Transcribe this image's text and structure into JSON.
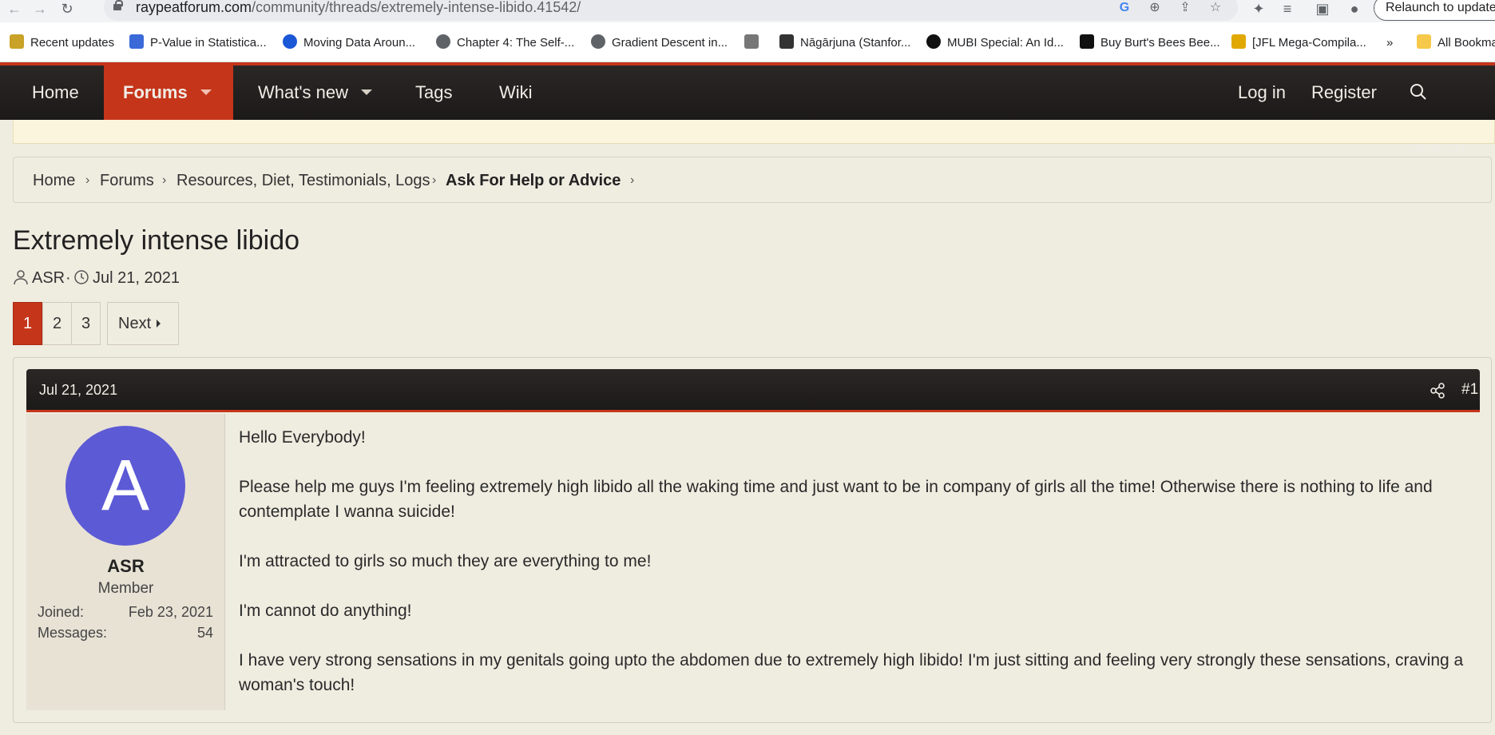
{
  "browser": {
    "url_domain": "raypeatforum.com",
    "url_path": "/community/threads/extremely-intense-libido.41542/",
    "relaunch_label": "Relaunch to update",
    "bookmarks": [
      {
        "label": "Recent updates",
        "color": "#c9a227"
      },
      {
        "label": "P-Value in Statistica...",
        "color": "#3b6ad8"
      },
      {
        "label": "Moving Data Aroun...",
        "color": "#1a57d6"
      },
      {
        "label": "Chapter 4: The Self-...",
        "color": "#5f6368"
      },
      {
        "label": "Gradient Descent in...",
        "color": "#5f6368"
      },
      {
        "label": "",
        "color": "#777777"
      },
      {
        "label": "Nāgārjuna (Stanfor...",
        "color": "#333333"
      },
      {
        "label": "MUBI Special: An Id...",
        "color": "#111111"
      },
      {
        "label": "Buy Burt's Bees Bee...",
        "color": "#111111"
      },
      {
        "label": "[JFL Mega-Compila...",
        "color": "#e0a800"
      },
      {
        "label": "»",
        "color": ""
      },
      {
        "label": "All Bookma",
        "color": "#f6c94a"
      }
    ]
  },
  "nav": {
    "home": "Home",
    "forums": "Forums",
    "whats_new": "What's new",
    "tags": "Tags",
    "wiki": "Wiki",
    "login": "Log in",
    "register": "Register",
    "search": "Search"
  },
  "breadcrumb": [
    "Home",
    "Forums",
    "Resources, Diet, Testimonials, Logs",
    "Ask For Help or Advice"
  ],
  "thread": {
    "title": "Extremely intense libido",
    "author": "ASR",
    "date": "Jul 21, 2021"
  },
  "pagination": {
    "pages": [
      "1",
      "2",
      "3"
    ],
    "current": "1",
    "next_label": "Next"
  },
  "post": {
    "date": "Jul 21, 2021",
    "number": "#1",
    "avatar_letter": "A",
    "avatar_color": "#5d5ad6",
    "username": "ASR",
    "user_title": "Member",
    "joined_label": "Joined:",
    "joined_value": "Feb 23, 2021",
    "messages_label": "Messages:",
    "messages_value": "54",
    "paragraphs": [
      "Hello Everybody!",
      "Please help me guys I'm feeling extremely high libido all the waking time and just want to be in company of girls all the time! Otherwise there is nothing to life and contemplate I wanna suicide!",
      "I'm attracted to girls so much they are everything to me!",
      "I'm cannot do anything!",
      "I have very strong sensations in my genitals going upto the abdomen due to extremely high libido! I'm just sitting and feeling very strongly these sensations, craving a woman's touch!"
    ]
  },
  "colors": {
    "accent": "#c5351a",
    "navbar": "#1c1a19",
    "page_bg": "#efece0"
  }
}
